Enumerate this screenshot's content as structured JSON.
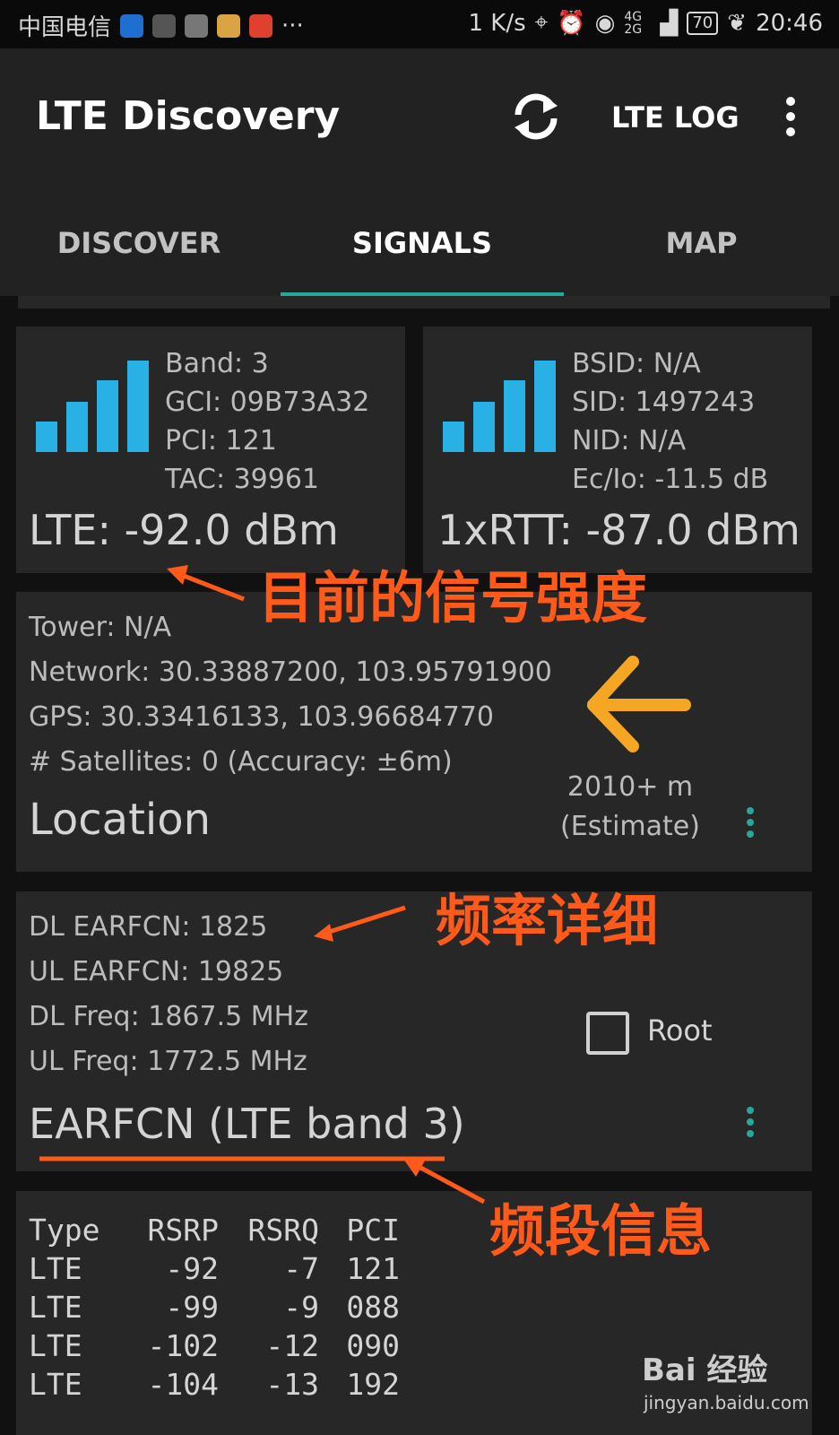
{
  "status_bar": {
    "carrier": "中国电信",
    "more": "···",
    "speed": "1 K/s",
    "network": "4G 2G",
    "battery": "70",
    "time": "20:46"
  },
  "app_bar": {
    "title": "LTE Discovery",
    "refresh_icon": "refresh-icon",
    "log_label": "LTE LOG",
    "overflow_icon": "overflow-menu-icon"
  },
  "tabs": [
    {
      "label": "DISCOVER",
      "selected": false
    },
    {
      "label": "SIGNALS",
      "selected": true
    },
    {
      "label": "MAP",
      "selected": false
    }
  ],
  "lte_card": {
    "band": "Band: 3",
    "gci": "GCI: 09B73A32",
    "pci": "PCI: 121",
    "tac": "TAC: 39961",
    "strength": "LTE: -92.0 dBm"
  },
  "cdma_card": {
    "bsid": "BSID: N/A",
    "sid": "SID: 1497243",
    "nid": "NID: N/A",
    "ecio": "Ec/Io: -11.5 dB",
    "strength": "1xRTT: -87.0 dBm"
  },
  "location_card": {
    "tower": "Tower: N/A",
    "network": "Network: 30.33887200, 103.95791900",
    "gps": "GPS: 30.33416133, 103.96684770",
    "satellites": "# Satellites: 0 (Accuracy: ±6m)",
    "title": "Location",
    "distance": "2010+ m",
    "estimate": "(Estimate)"
  },
  "earfcn_card": {
    "dl_earfcn": "DL EARFCN: 1825",
    "ul_earfcn": "UL EARFCN: 19825",
    "dl_freq": "DL Freq: 1867.5 MHz",
    "ul_freq": "UL Freq: 1772.5 MHz",
    "root_label": "Root",
    "root_checked": false,
    "title": "EARFCN (LTE band 3)"
  },
  "neighbor_table": {
    "headers": [
      "Type",
      "RSRP",
      "RSRQ",
      "PCI"
    ],
    "rows": [
      [
        "LTE",
        "-92",
        "-7",
        "121"
      ],
      [
        "LTE",
        "-99",
        "-9",
        "088"
      ],
      [
        "LTE",
        "-102",
        "-12",
        "090"
      ],
      [
        "LTE",
        "-104",
        "-13",
        "192"
      ]
    ]
  },
  "annotations": {
    "signal_strength": "目前的信号强度",
    "frequency_detail": "频率详细",
    "band_info": "频段信息"
  },
  "watermark": {
    "brand": "Bai 经验",
    "url": "jingyan.baidu.com"
  },
  "colors": {
    "accent": "#27a89a",
    "signal_bar": "#29b1e6",
    "annotation": "#ff5a1a",
    "annotation_arrow_yellow": "#f5a623"
  }
}
